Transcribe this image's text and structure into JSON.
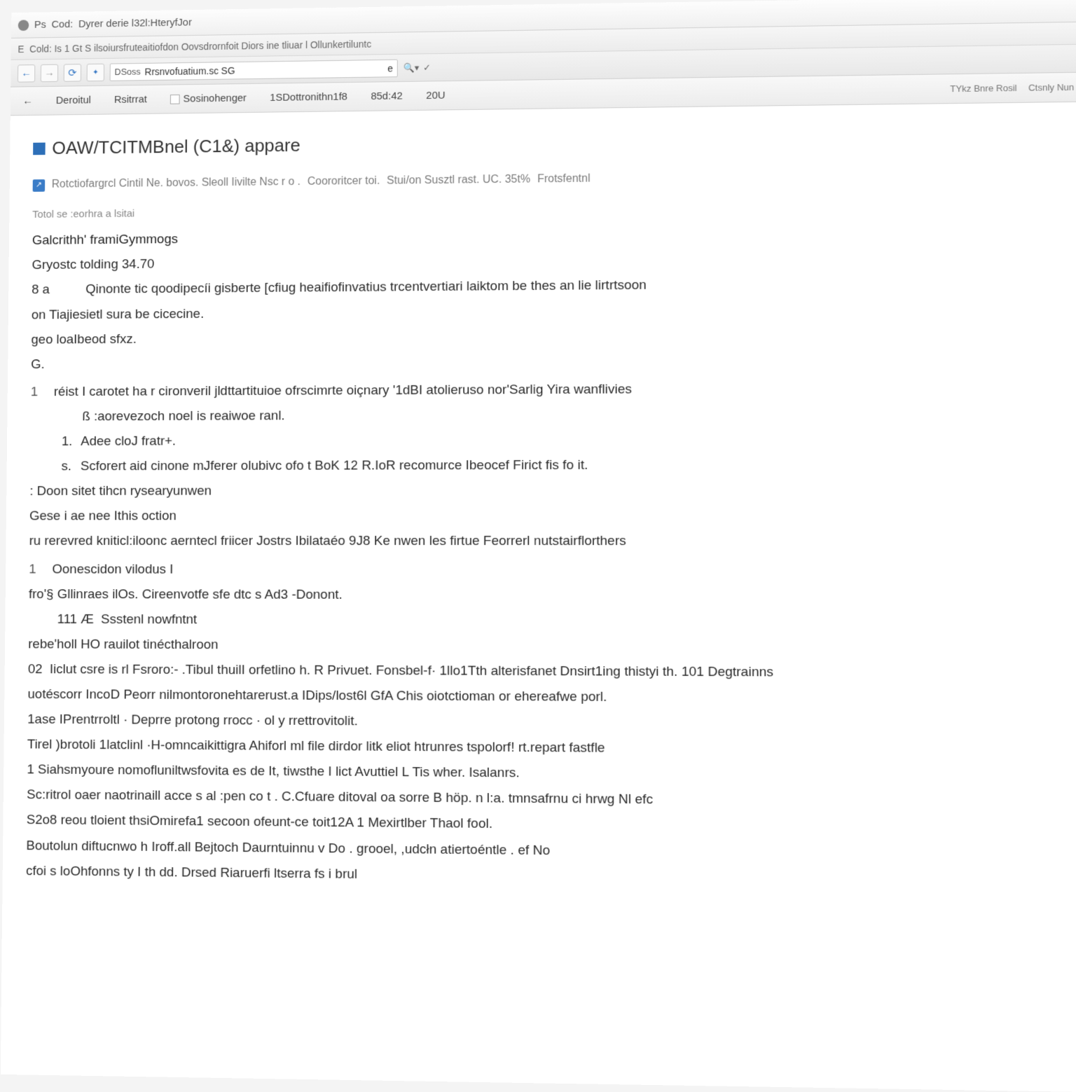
{
  "titlebar": {
    "app_glyph": "Ps",
    "tab1": "Cod:",
    "tab2": "Dyrer derie l32l:HteryfJor"
  },
  "wintitle": {
    "left_glyph": "E",
    "text": "Cold: Is 1  Gt S ilsoiursfruteaitiofdon Oovsdrornfoit Diors ine tliuar l   Ollunkertiluntc"
  },
  "addressbar": {
    "back": "←",
    "fwd": "→",
    "reload": "⟳",
    "dsos_label": "DSoss",
    "url": "Rrsnvofuatium.sc   SG",
    "suffix": "e",
    "search_icon": "🔍▾",
    "check": "✓"
  },
  "toolbar": {
    "left_arrow": "←",
    "items": [
      "Deroitul",
      "Rsitrrat",
      "Sosinohenger",
      "1SDottronithn1f8",
      "85d:42",
      "20U"
    ],
    "right": [
      "TYkz Bnre Rosil",
      "Ctsnly   Nun"
    ]
  },
  "page": {
    "title": "OAW/TCITMBnel (C1&) appare",
    "crumbs": [
      "Rotctiofargrcl Cintil Ne. bovos. Sleoll Iivilte Nsc r o .",
      "Coororitcer toi.",
      "Stui/on Susztl rast. UC. 35t%",
      "Frotsfentnl"
    ]
  },
  "body": {
    "section_label": "Totol se :eorhra a lsitai",
    "l1": "Galcrithh' framiGymmogs",
    "l2": "Gryostc tolding 34.70",
    "l3_pre": "8 a",
    "l3": "Qinonte tic qoodipecíi gisberte [cfiug heaifiofinvatius trcentvertiari laiktom be thes an lie lirtrtsoon",
    "l4": "on Tiajiesietl sura be cicecine.",
    "l5": "geo loaIbeod sfxz.",
    "l6": "G.",
    "list1": [
      {
        "n": "1",
        "t": "réist I carotet ha r cironveril jldttartituioe ofrscimrte oiçnary '1dBI atolieruso nor'Sarlig   Yira wanflivies"
      },
      {
        "n": "",
        "t": "ß :aorevezoch  noel is reaiwoe ranl."
      }
    ],
    "sub1": [
      {
        "b": "1.",
        "t": "Adee cloJ fratr+."
      },
      {
        "b": "s.",
        "t": "Scforert  aid cinone mJferer olubivc ofo t BoK 12 R.IoR recomurce Ibeocef Firict fis fo it."
      }
    ],
    "l7": ":  Doon sitet tihcn rysearyunwen",
    "l8": "Gese i  ae nee Ithis oction",
    "l9": "ru rerevred kniticl:iloonc aerntecl friicer Jostrs Ibilataéo 9J8 Ke nwen les firtue Feorrerl  nutstairflorthers",
    "list2": [
      {
        "n": "1",
        "t": "Oonescidon vilodus I"
      }
    ],
    "l10": "fro'§ Gllinraes ilOs.   Cireenvotfe sfe dtc s Ad3  -Donont.",
    "l11_pre": "111 Æ",
    "l11": "Ssstenl nowfntnt",
    "l12": "rebe'holl HO  rauilot tinécthalroon",
    "l13_pre": "02",
    "l13": "Iiclut csre is rl Fsroro:- .Tibul thuilI   orfetlino h. R  Privuet. Fonsbel-f· 1llo1Tth alterisfanet  Dnsirt1ing thistyi th. 101 Degtrainns",
    "l14": "uotéscorr IncoD  Peorr nilmontoronehtarerust.a IDips/lost6l GfA Chis oiotctioman or ehereafwe porl.",
    "l15": "1ase IPrentrroltl · Deprre protong rrocc ·   ol y rrettrovitolit.",
    "l16": "Tirel )brotoli 1latclinl ·H-omncaikittigra Ahiforl ml file  dirdor litk  eliot  htrunres tspolorf! rt.repart fastfle",
    "l17": "1 Siahsmyoure nomofluniltwsfovita es  de It, tiwsthe I lict Avuttiel L Tis wher.  Isalanrs.",
    "l18": "Sc:ritrol oaer naotrinaill acce s  al  :pen co t . C.Cfuare ditoval oa sorre B höp. n l:a.   tmnsafrnu  ci hrwg  Nl efc",
    "l19": "S2o8 reou tloient thsiOmirefa1 secoon  ofeunt-ce toit12A 1 Mexirtlber Thaol fool.",
    "l20": "Boutolun diftucnwo  h Iroff.all Bejtoch Daurntuinnu v Do  . grooel, ,udcłn atiertoéntle .  ef No",
    "l21": "                        cfoi s loOhfonns    ty I th dd. Drsed Riaruerfi ltserra fs i brul"
  }
}
